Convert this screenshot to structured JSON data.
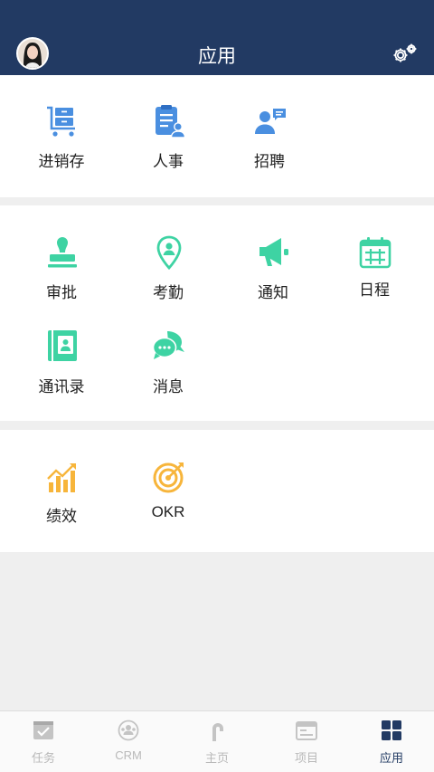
{
  "header": {
    "title": "应用"
  },
  "sections": [
    {
      "apps": [
        {
          "label": "进销存",
          "icon": "cart-icon"
        },
        {
          "label": "人事",
          "icon": "clipboard-person-icon"
        },
        {
          "label": "招聘",
          "icon": "person-message-icon"
        }
      ]
    },
    {
      "apps": [
        {
          "label": "审批",
          "icon": "stamp-icon"
        },
        {
          "label": "考勤",
          "icon": "location-pin-icon"
        },
        {
          "label": "通知",
          "icon": "megaphone-icon"
        },
        {
          "label": "日程",
          "icon": "calendar-icon"
        },
        {
          "label": "通讯录",
          "icon": "contacts-book-icon"
        },
        {
          "label": "消息",
          "icon": "chat-bubbles-icon"
        }
      ]
    },
    {
      "apps": [
        {
          "label": "绩效",
          "icon": "bar-chart-icon"
        },
        {
          "label": "OKR",
          "icon": "target-icon"
        }
      ]
    }
  ],
  "tabs": [
    {
      "label": "任务",
      "icon": "task-check-icon"
    },
    {
      "label": "CRM",
      "icon": "crm-icon"
    },
    {
      "label": "主页",
      "icon": "home-icon"
    },
    {
      "label": "项目",
      "icon": "project-icon"
    },
    {
      "label": "应用",
      "icon": "apps-grid-icon",
      "active": true
    }
  ],
  "colors": {
    "header": "#223a63",
    "blue": "#4a8fe0",
    "green": "#3ed3a3",
    "orange": "#f7b53b",
    "tab_inactive": "#b9b9b9",
    "tab_active": "#223a63"
  }
}
